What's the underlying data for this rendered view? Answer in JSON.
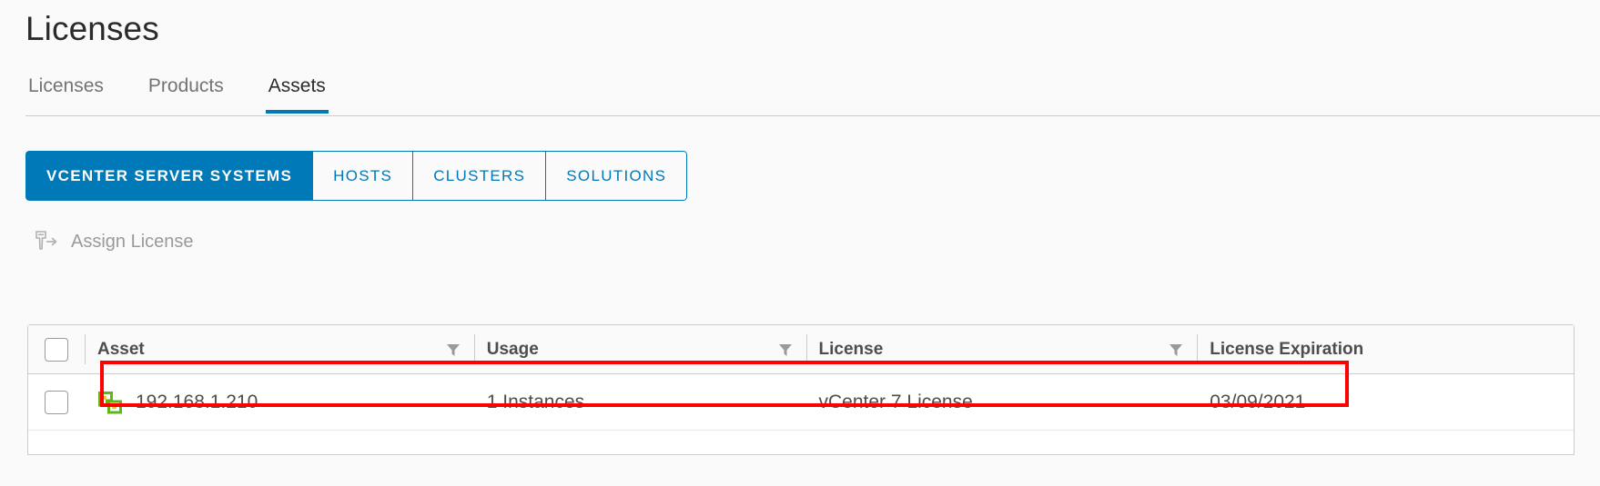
{
  "header": {
    "title": "Licenses"
  },
  "tabs": [
    {
      "label": "Licenses",
      "active": false
    },
    {
      "label": "Products",
      "active": false
    },
    {
      "label": "Assets",
      "active": true
    }
  ],
  "button_group": [
    {
      "label": "VCENTER SERVER SYSTEMS",
      "selected": true
    },
    {
      "label": "HOSTS",
      "selected": false
    },
    {
      "label": "CLUSTERS",
      "selected": false
    },
    {
      "label": "SOLUTIONS",
      "selected": false
    }
  ],
  "action_bar": {
    "assign_license_label": "Assign License",
    "assign_license_icon": "assign-license-icon",
    "disabled": true
  },
  "table": {
    "select_all_checkbox": "select-all-checkbox",
    "columns": [
      {
        "label": "Asset",
        "filterable": true
      },
      {
        "label": "Usage",
        "filterable": true
      },
      {
        "label": "License",
        "filterable": true
      },
      {
        "label": "License Expiration",
        "filterable": false
      }
    ],
    "rows": [
      {
        "selected": false,
        "icon": "vcenter-server-icon",
        "asset": "192.168.1.210",
        "usage": "1 Instances",
        "license": "vCenter 7 License",
        "license_expiration": "03/09/2021",
        "highlighted": true
      }
    ]
  },
  "colors": {
    "accent_blue": "#0079b8",
    "highlight_red": "#ff0000",
    "icon_green": "#5eb715",
    "icon_amber": "#f7bf2b",
    "page_background": "#fafafa",
    "text_primary": "#2b2b2b",
    "text_muted": "#737373",
    "disabled_text": "#9a9a9a"
  }
}
